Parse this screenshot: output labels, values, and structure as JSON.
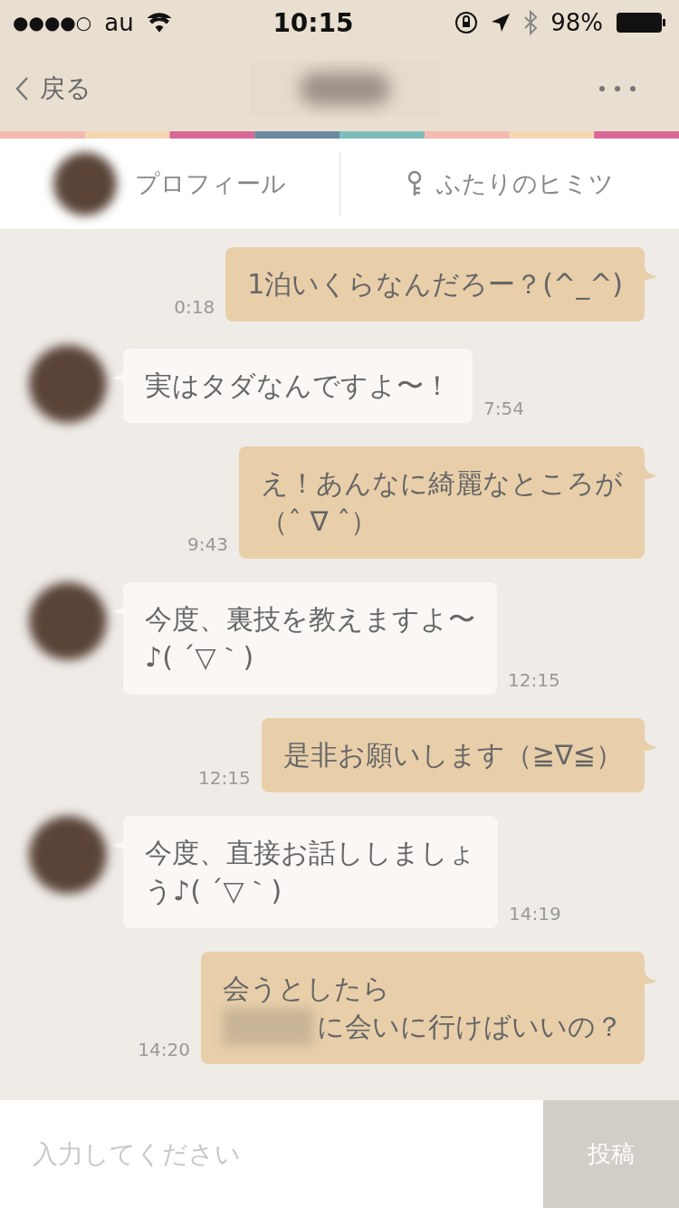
{
  "status_bar": {
    "signal_dots": "●●●●○",
    "carrier": "au",
    "time": "10:15",
    "battery": "98%"
  },
  "nav": {
    "back": "戻る",
    "title_redacted": true
  },
  "tabs": [
    {
      "label": "プロフィール",
      "kind": "avatar"
    },
    {
      "label": "ふたりのヒミツ",
      "kind": "key"
    }
  ],
  "messages": [
    {
      "kind": "sent",
      "time": "0:18",
      "lines": [
        "1泊いくらなんだろー？(^_^)"
      ]
    },
    {
      "kind": "received",
      "time": "7:54",
      "lines": [
        "実はタダなんですよ〜！"
      ]
    },
    {
      "kind": "sent",
      "time": "9:43",
      "lines": [
        "え！あんなに綺麗なところが",
        "（ˆ ∇ ˆ）"
      ]
    },
    {
      "kind": "received",
      "time": "12:15",
      "lines": [
        "今度、裏技を教えますよ〜",
        "♪( ´▽｀)"
      ]
    },
    {
      "kind": "sent",
      "time": "12:15",
      "lines": [
        "是非お願いします（≧∇≦）"
      ]
    },
    {
      "kind": "received",
      "time": "14:19",
      "lines": [
        "今度、直接お話ししましょ",
        "う♪( ´▽｀)"
      ]
    },
    {
      "kind": "sent",
      "time": "14:20",
      "lines": [
        "会うとしたら",
        "に会いに行けばいいの？"
      ],
      "last_line_redacted_prefix": true
    }
  ],
  "composer": {
    "placeholder": "入力してください",
    "send": "投稿"
  }
}
